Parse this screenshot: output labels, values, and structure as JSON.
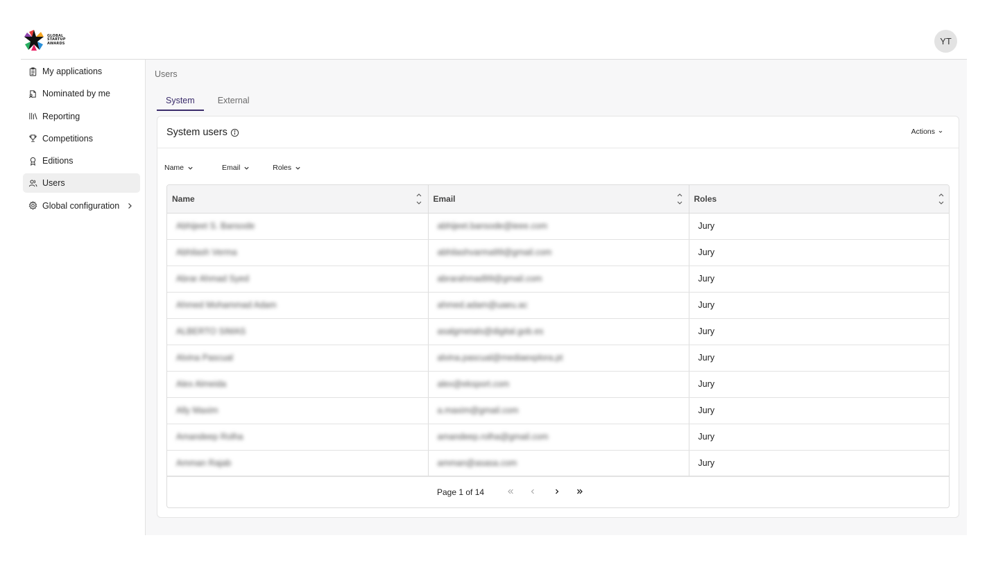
{
  "logo": {
    "line1": "GLOBAL",
    "line2": "STARTUP",
    "line3": "AWARDS"
  },
  "user": {
    "initials": "YT"
  },
  "sidebar": {
    "items": [
      {
        "label": "My applications",
        "icon": "clipboard-icon"
      },
      {
        "label": "Nominated by me",
        "icon": "document-user-icon"
      },
      {
        "label": "Reporting",
        "icon": "library-icon"
      },
      {
        "label": "Competitions",
        "icon": "trophy-icon"
      },
      {
        "label": "Editions",
        "icon": "award-icon"
      },
      {
        "label": "Users",
        "icon": "users-icon"
      },
      {
        "label": "Global configuration",
        "icon": "gear-icon"
      }
    ]
  },
  "main": {
    "page_title": "Users",
    "tabs": [
      {
        "label": "System"
      },
      {
        "label": "External"
      }
    ],
    "card_title": "System users",
    "actions_label": "Actions",
    "filters": [
      {
        "label": "Name"
      },
      {
        "label": "Email"
      },
      {
        "label": "Roles"
      }
    ],
    "columns": [
      "Name",
      "Email",
      "Roles"
    ],
    "rows": [
      {
        "name": "Abhijeet S. Bansode",
        "email": "abhijeet.bansode@ieee.com",
        "role": "Jury"
      },
      {
        "name": "Abhilash Verma",
        "email": "abhilashvarma99@gmail.com",
        "role": "Jury"
      },
      {
        "name": "Abrar Ahmad Syed",
        "email": "abrarahmad99@gmail.com",
        "role": "Jury"
      },
      {
        "name": "Ahmed Mohammad Adam",
        "email": "ahmed.adam@uaeu.ac",
        "role": "Jury"
      },
      {
        "name": "ALBERTO SIMAS",
        "email": "asalgmetals@digital.gob.es",
        "role": "Jury"
      },
      {
        "name": "Alvina Pascual",
        "email": "alvina.pascual@mediaexplora.pt",
        "role": "Jury"
      },
      {
        "name": "Alex Almeida",
        "email": "alex@eksport.com",
        "role": "Jury"
      },
      {
        "name": "Ally Maxim",
        "email": "a.maxim@gmail.com",
        "role": "Jury"
      },
      {
        "name": "Amandeep Rolha",
        "email": "amandeep.rolha@gmail.com",
        "role": "Jury"
      },
      {
        "name": "Amman Rajab",
        "email": "amman@asasa.com",
        "role": "Jury"
      }
    ],
    "pagination": {
      "text": "Page 1 of 14"
    }
  }
}
